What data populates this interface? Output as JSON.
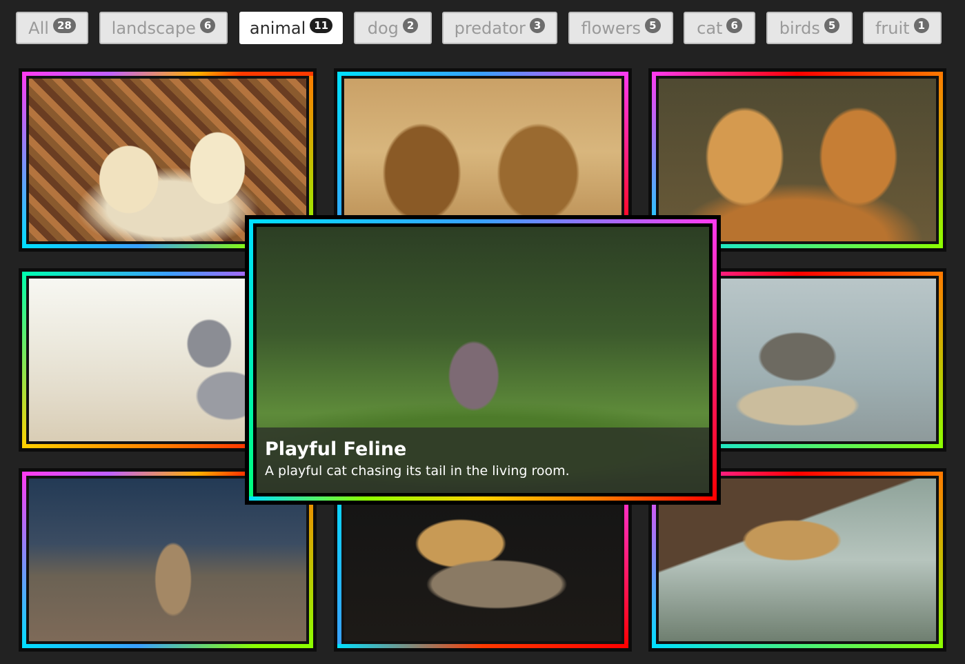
{
  "filters": [
    {
      "label": "All",
      "count": "28",
      "active": false
    },
    {
      "label": "landscape",
      "count": "6",
      "active": false
    },
    {
      "label": "animal",
      "count": "11",
      "active": true
    },
    {
      "label": "dog",
      "count": "2",
      "active": false
    },
    {
      "label": "predator",
      "count": "3",
      "active": false
    },
    {
      "label": "flowers",
      "count": "5",
      "active": false
    },
    {
      "label": "cat",
      "count": "6",
      "active": false
    },
    {
      "label": "birds",
      "count": "5",
      "active": false
    },
    {
      "label": "fruit",
      "count": "1",
      "active": false
    }
  ],
  "featured": {
    "title": "Playful Feline",
    "description": "A playful cat chasing its tail in the living room."
  },
  "colors": {
    "background": "#222222",
    "active_filter_bg": "#ffffff",
    "inactive_filter_bg": "#e6e6e6",
    "badge_active": "#1d1d1d",
    "badge_inactive": "#6c6c6c"
  }
}
